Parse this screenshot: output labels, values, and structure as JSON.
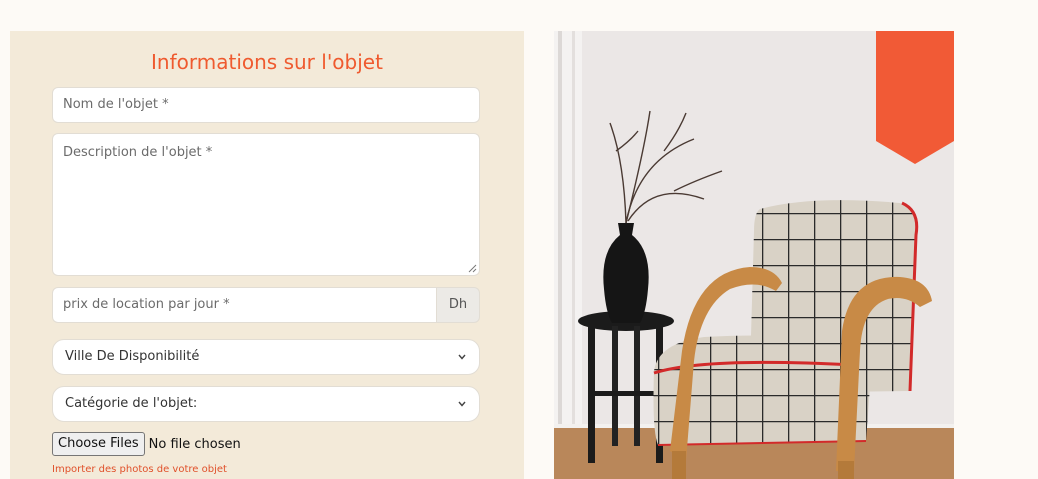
{
  "form": {
    "title": "Informations sur l'objet",
    "name_placeholder": "Nom de l'objet *",
    "description_placeholder": "Description de l'objet *",
    "price_placeholder": "prix de location par jour *",
    "price_unit": "Dh",
    "city_select": "Ville De Disponibilité",
    "category_select": "Catégorie de l'objet:",
    "file_button": "Choose Files",
    "file_status": "No file chosen",
    "file_help": "Importer des photos de votre objet"
  },
  "icons": {
    "select_chevron": "chevron-down-icon",
    "resize": "resize-grip-icon"
  },
  "colors": {
    "accent": "#ef5a2f",
    "panel": "#f3ead9",
    "page": "#fdfaf6",
    "banner": "#f15a36"
  }
}
